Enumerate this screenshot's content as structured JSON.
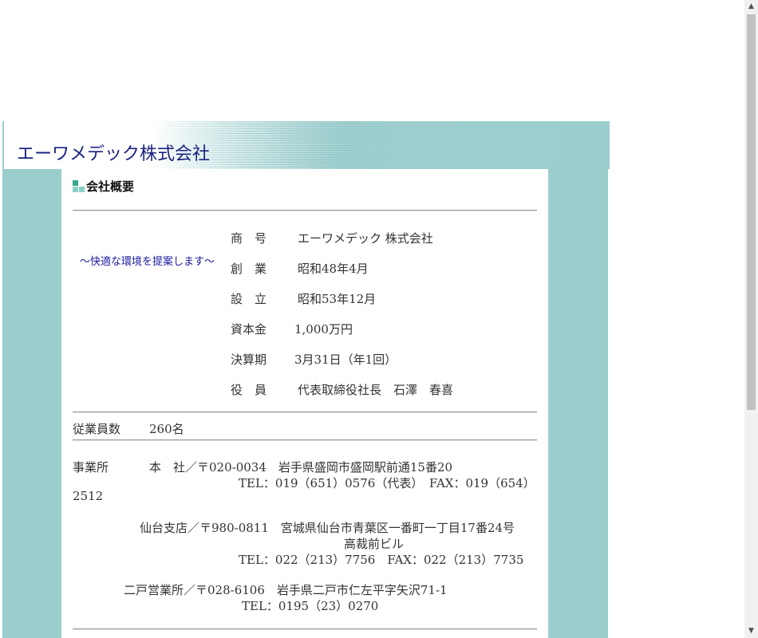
{
  "header": {
    "logo_text": "エーワメデック株式会社"
  },
  "section": {
    "title": "会社概要",
    "tagline": "～快適な環境を提案します～"
  },
  "profile": [
    {
      "label": "商　号",
      "value": "エーワメデック 株式会社"
    },
    {
      "label": "創　業",
      "value": "昭和48年4月"
    },
    {
      "label": "設　立",
      "value": "昭和53年12月"
    },
    {
      "label": "資本金",
      "value": "1,000万円"
    },
    {
      "label": "決算期",
      "value": "3月31日（年1回）"
    },
    {
      "label": "役　員",
      "value": "代表取締役社長　石澤　春喜"
    }
  ],
  "employees": {
    "label": "従業員数",
    "value": "260名"
  },
  "offices": {
    "label": "事業所",
    "head_office": {
      "name": "本　社／〒020-0034　岩手県盛岡市盛岡駅前通15番20",
      "tel": "TEL：019（651）0576（代表）　FAX：019（654）",
      "tel_cont": "2512"
    },
    "sendai": {
      "name": "仙台支店／〒980-0811　宮城県仙台市青葉区一番町一丁目17番24号",
      "building": "高裁前ビル",
      "tel": "TEL：022（213）7756　FAX：022（213）7735"
    },
    "ninohe": {
      "name": "二戸営業所／〒028-6106　岩手県二戸市仁左平字矢沢71-1",
      "tel": "TEL：0195（23）0270"
    }
  },
  "colors": {
    "accent_teal": "#9bcdcd",
    "logo_navy": "#1a237e",
    "tagline_blue": "#1a1aa0"
  },
  "icons": {
    "scroll_up": "▲",
    "scroll_down": "▼"
  }
}
